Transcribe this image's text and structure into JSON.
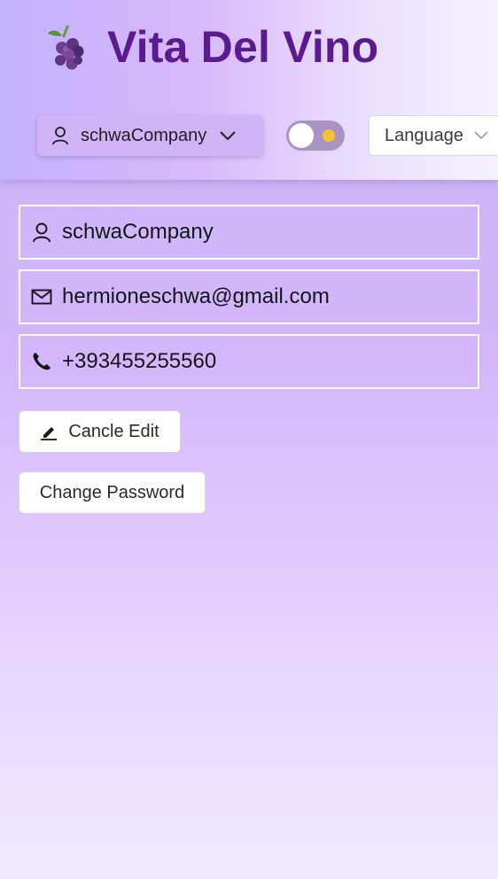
{
  "header": {
    "brand_title": "Vita Del Vino",
    "logo_icon": "grapes-icon",
    "user_menu": {
      "label": "schwaCompany",
      "icon": "user-icon",
      "chevron": "chevron-down-icon"
    },
    "theme_toggle": {
      "state": "light",
      "indicator_color": "#f7c232"
    },
    "language_select": {
      "label": "Language",
      "chevron": "chevron-down-icon"
    }
  },
  "profile": {
    "username": {
      "icon": "user-icon",
      "value": "schwaCompany"
    },
    "email": {
      "icon": "mail-icon",
      "value": "hermioneschwa@gmail.com"
    },
    "phone": {
      "icon": "phone-icon",
      "value": "+393455255560"
    }
  },
  "actions": {
    "cancel_edit": {
      "label": "Cancle Edit",
      "icon": "pencil-icon"
    },
    "change_password": {
      "label": "Change Password"
    }
  },
  "colors": {
    "brand": "#5a1b8f",
    "accent": "#d0b4f7",
    "toggle_track": "#a993c2"
  }
}
